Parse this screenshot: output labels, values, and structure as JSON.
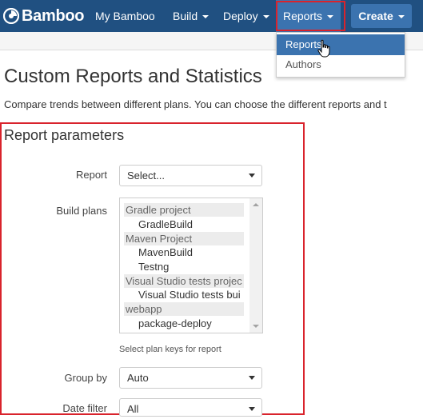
{
  "nav": {
    "logo_text": "Bamboo",
    "items": [
      {
        "label": "My Bamboo"
      },
      {
        "label": "Build"
      },
      {
        "label": "Deploy"
      },
      {
        "label": "Reports"
      }
    ],
    "create_label": "Create"
  },
  "reports_menu": {
    "items": [
      {
        "label": "Reports"
      },
      {
        "label": "Authors"
      }
    ]
  },
  "page": {
    "title": "Custom Reports and Statistics",
    "description": "Compare trends between different plans. You can choose the different reports and t"
  },
  "form": {
    "section_title": "Report parameters",
    "report_label": "Report",
    "report_value": "Select...",
    "build_plans_label": "Build plans",
    "build_plans": [
      {
        "group": "Gradle project",
        "plans": [
          "GradleBuild"
        ]
      },
      {
        "group": "Maven Project",
        "plans": [
          "MavenBuild",
          "Testng"
        ]
      },
      {
        "group": "Visual Studio tests projec",
        "plans": [
          "Visual Studio tests bui"
        ]
      },
      {
        "group": "webapp",
        "plans": [
          "package-deploy"
        ]
      }
    ],
    "build_plans_help": "Select plan keys for report",
    "group_by_label": "Group by",
    "group_by_value": "Auto",
    "date_filter_label": "Date filter",
    "date_filter_value": "All"
  },
  "colors": {
    "nav_bg": "#205081",
    "nav_active": "#3b73af",
    "highlight_border": "#d9232c"
  }
}
